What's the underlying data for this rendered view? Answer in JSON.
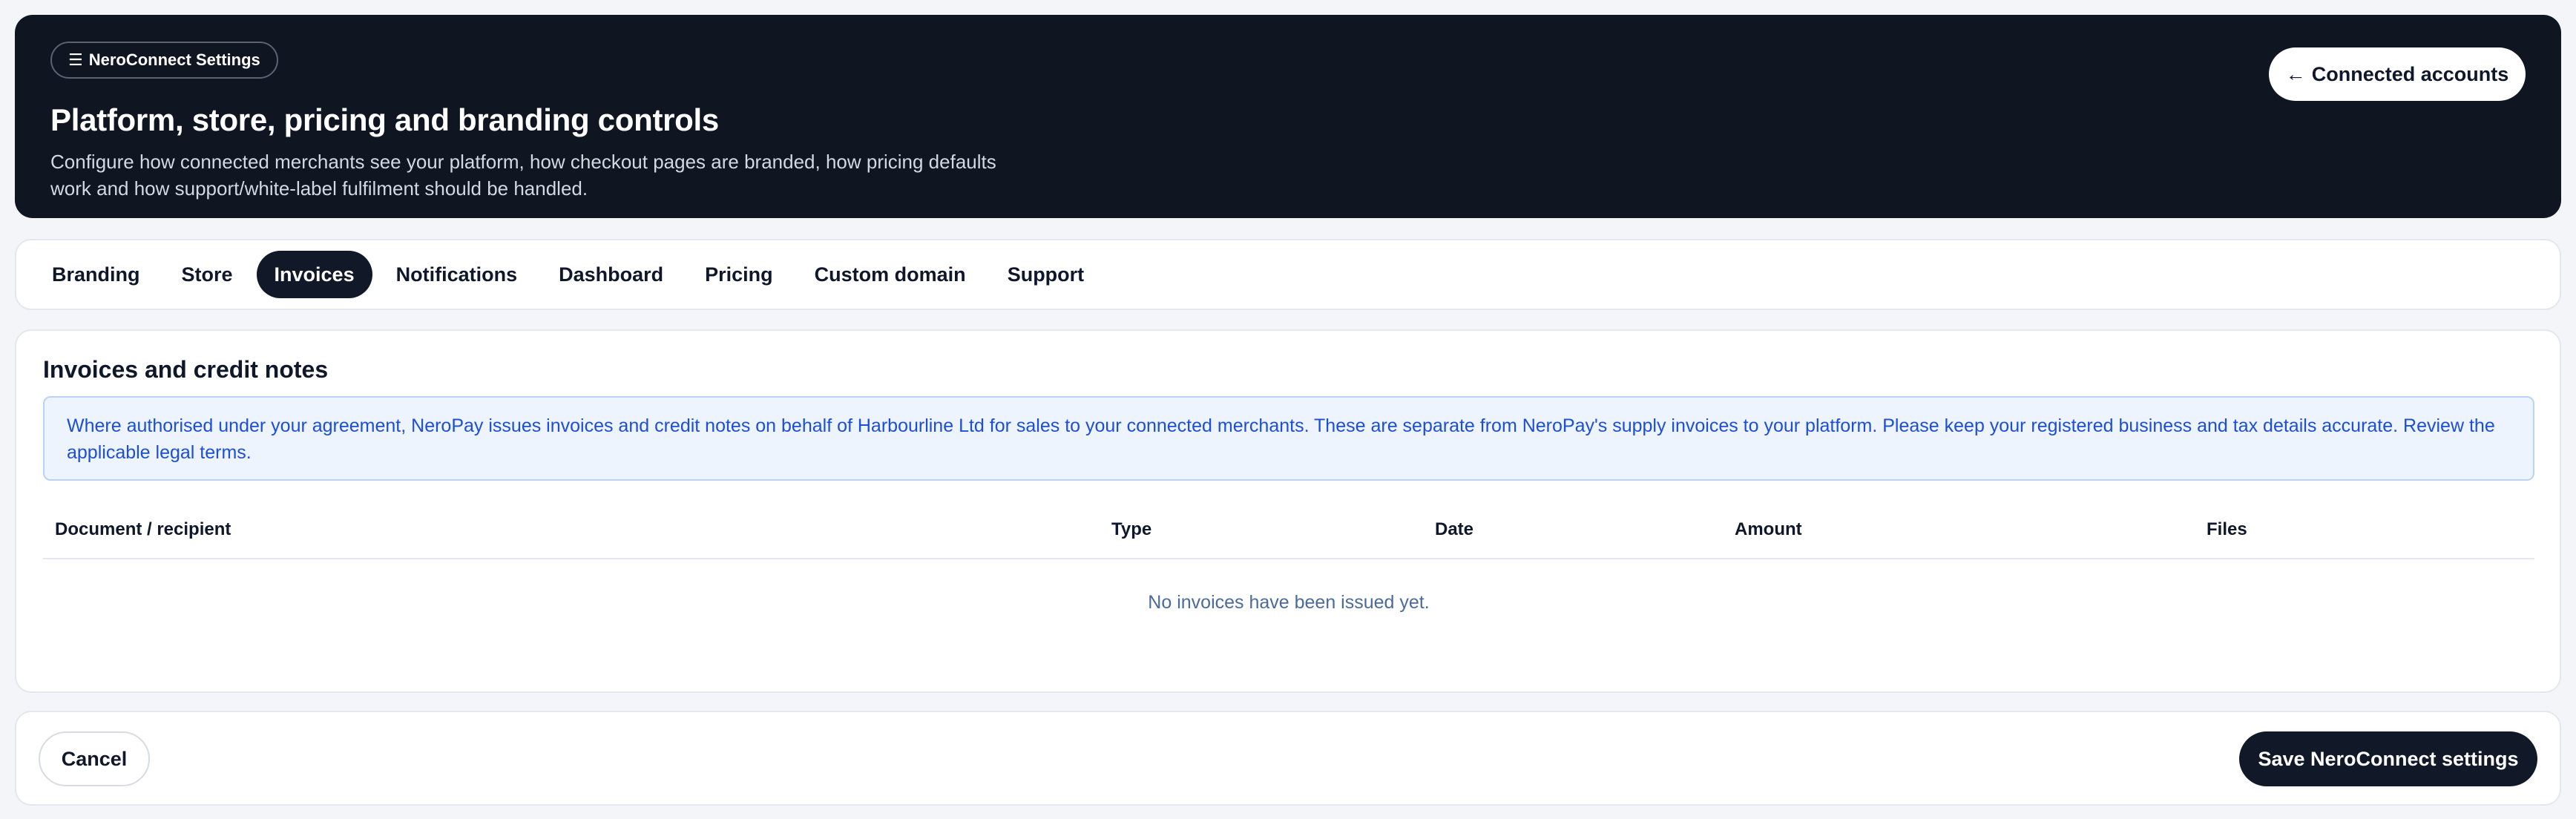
{
  "header": {
    "badge_icon": "☰",
    "badge_label": "NeroConnect Settings",
    "title": "Platform, store, pricing and branding controls",
    "description": "Configure how connected merchants see your platform, how checkout pages are branded, how pricing defaults work and how support/white-label fulfilment should be handled.",
    "back_arrow": "←",
    "back_label": "Connected accounts"
  },
  "tabs": {
    "items": [
      {
        "label": "Branding"
      },
      {
        "label": "Store"
      },
      {
        "label": "Invoices"
      },
      {
        "label": "Notifications"
      },
      {
        "label": "Dashboard"
      },
      {
        "label": "Pricing"
      },
      {
        "label": "Custom domain"
      },
      {
        "label": "Support"
      }
    ],
    "active": "Invoices"
  },
  "invoices": {
    "title": "Invoices and credit notes",
    "notice": "Where authorised under your agreement, NeroPay issues invoices and credit notes on behalf of Harbourline Ltd for sales to your connected merchants. These are separate from NeroPay's supply invoices to your platform. Please keep your registered business and tax details accurate. Review the applicable legal terms.",
    "columns": [
      "Document / recipient",
      "Type",
      "Date",
      "Amount",
      "Files"
    ],
    "rows": [],
    "empty_message": "No invoices have been issued yet."
  },
  "footer": {
    "cancel_label": "Cancel",
    "save_label": "Save NeroConnect settings"
  },
  "colors": {
    "hero_bg": "#0f1521",
    "accent_dark": "#111827",
    "notice_bg": "#edf4fe",
    "notice_text": "#1d4ed8",
    "page_bg": "#f3f5f9"
  }
}
